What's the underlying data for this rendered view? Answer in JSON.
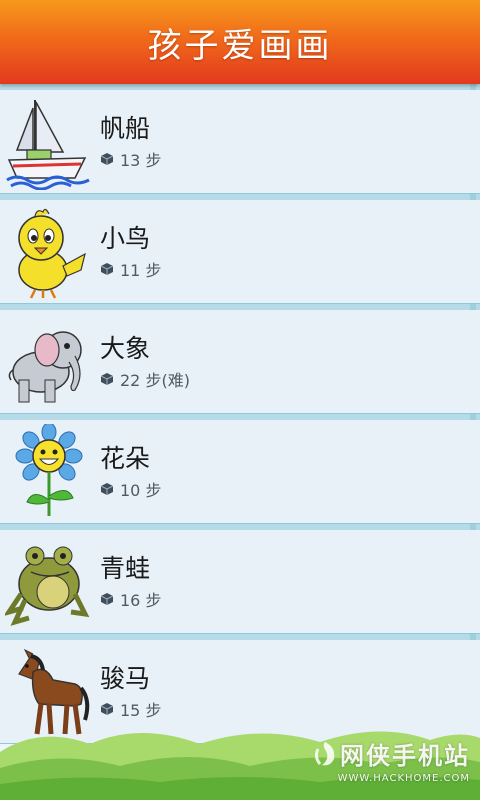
{
  "app": {
    "title": "孩子爱画画"
  },
  "items": [
    {
      "name": "帆船",
      "steps": "13 步",
      "icon": "sailboat-icon"
    },
    {
      "name": "小鸟",
      "steps": "11 步",
      "icon": "bird-icon"
    },
    {
      "name": "大象",
      "steps": "22 步(难)",
      "icon": "elephant-icon"
    },
    {
      "name": "花朵",
      "steps": "10 步",
      "icon": "flower-icon"
    },
    {
      "name": "青蛙",
      "steps": "16 步",
      "icon": "frog-icon"
    },
    {
      "name": "骏马",
      "steps": "15 步",
      "icon": "horse-icon"
    }
  ],
  "watermark": {
    "text": "网侠手机站",
    "url": "WWW.HACKHOME.COM"
  },
  "colors": {
    "header_top": "#f79a1c",
    "header_bottom": "#e23a1f",
    "row_bg": "#e9f1f8",
    "divider": "#b5dbe8"
  }
}
